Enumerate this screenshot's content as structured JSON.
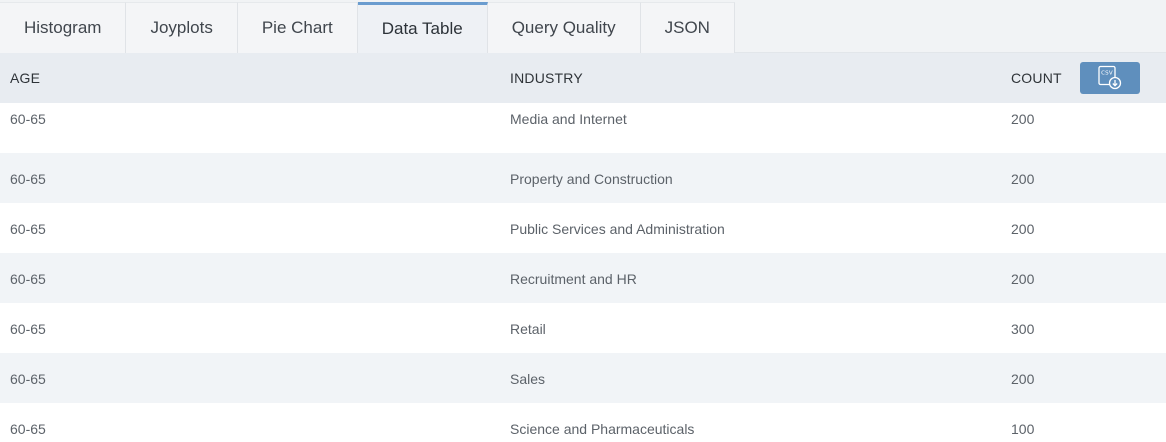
{
  "tabs": [
    {
      "label": "Histogram",
      "active": false
    },
    {
      "label": "Joyplots",
      "active": false
    },
    {
      "label": "Pie Chart",
      "active": false
    },
    {
      "label": "Data Table",
      "active": true
    },
    {
      "label": "Query Quality",
      "active": false
    },
    {
      "label": "JSON",
      "active": false
    }
  ],
  "table": {
    "headers": {
      "age": "AGE",
      "industry": "INDUSTRY",
      "count": "COUNT"
    },
    "csv_button": {
      "icon": "csv-download-icon",
      "icon_text": "CSV"
    },
    "rows": [
      {
        "age": "60-65",
        "industry": "Media and Internet",
        "count": "200"
      },
      {
        "age": "60-65",
        "industry": "Property and Construction",
        "count": "200"
      },
      {
        "age": "60-65",
        "industry": "Public Services and Administration",
        "count": "200"
      },
      {
        "age": "60-65",
        "industry": "Recruitment and HR",
        "count": "200"
      },
      {
        "age": "60-65",
        "industry": "Retail",
        "count": "300"
      },
      {
        "age": "60-65",
        "industry": "Sales",
        "count": "200"
      },
      {
        "age": "60-65",
        "industry": "Science and Pharmaceuticals",
        "count": "100"
      }
    ]
  },
  "colors": {
    "accent": "#6a9ccf",
    "csv_button_bg": "#5f8fbd",
    "header_bg": "#e8ecf1",
    "row_alt_bg": "#f1f4f7"
  }
}
